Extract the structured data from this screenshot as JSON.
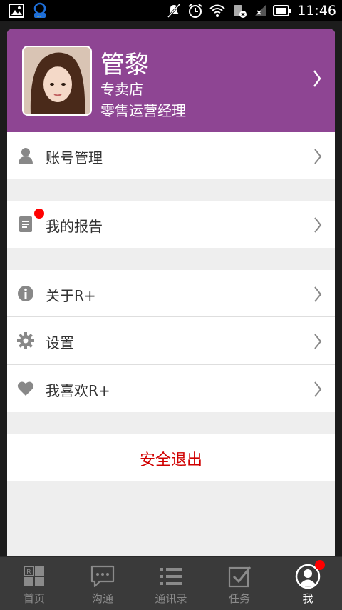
{
  "status_bar": {
    "time": "11:46",
    "icons": [
      "image-icon",
      "chat-notification-icon",
      "muted-icon",
      "alarm-icon",
      "wifi-icon",
      "sim-icon",
      "signal-icon",
      "battery-icon"
    ]
  },
  "profile": {
    "name": "管黎",
    "store": "专卖店",
    "role": "零售运营经理",
    "accent_color": "#8e4593"
  },
  "menu": {
    "account": "账号管理",
    "reports": "我的报告",
    "about": "关于R+",
    "settings": "设置",
    "like": "我喜欢R+",
    "logout": "安全退出",
    "logout_color": "#d00000"
  },
  "bottom_nav": {
    "items": [
      {
        "label": "首页",
        "icon": "home-icon"
      },
      {
        "label": "沟通",
        "icon": "chat-icon"
      },
      {
        "label": "通讯录",
        "icon": "contacts-list-icon"
      },
      {
        "label": "任务",
        "icon": "task-check-icon"
      },
      {
        "label": "我",
        "icon": "profile-icon",
        "active": true
      }
    ]
  }
}
